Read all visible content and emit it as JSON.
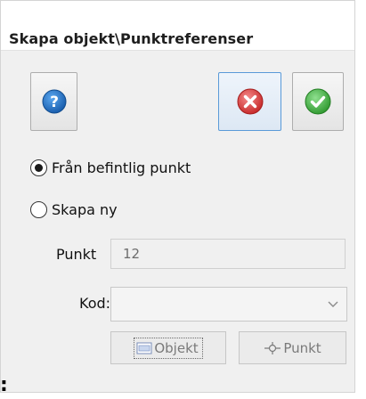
{
  "dialog": {
    "title": "Skapa objekt\\Punktreferenser"
  },
  "toolbar": {
    "help_icon": "help-question-icon",
    "cancel_icon": "cancel-x-icon",
    "ok_icon": "ok-check-icon",
    "colors": {
      "help": "#1f6fc4",
      "cancel": "#d63a3a",
      "ok": "#3aa83a",
      "focus_border": "#5a9ad8"
    }
  },
  "options": {
    "existing_label": "Från befintlig punkt",
    "existing_selected": true,
    "new_label": "Skapa ny",
    "new_selected": false
  },
  "form": {
    "punkt_label": "Punkt",
    "punkt_value": "12",
    "kod_label": "Kod:",
    "kod_value": ""
  },
  "actions": {
    "objekt_label": "Objekt",
    "punkt_label": "Punkt"
  },
  "footer": {
    "stray_text": ":"
  }
}
